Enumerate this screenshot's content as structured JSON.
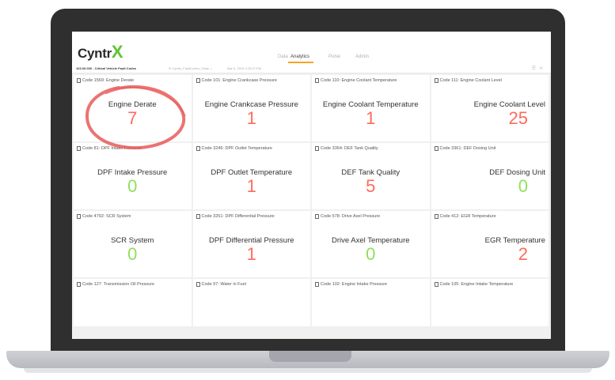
{
  "brand": {
    "name": "Cyntr",
    "accent_letter": "X"
  },
  "nav": {
    "tabs": [
      {
        "label": "Data",
        "active": false
      },
      {
        "label": "Analytics",
        "active": true
      },
      {
        "label": "Pulse",
        "active": false
      },
      {
        "label": "Admin",
        "active": false
      }
    ]
  },
  "subbar": {
    "title": "103.00.000 - Critical Vehicle Fault Codes",
    "source": "Cyntrx_FaultCodes_Clean",
    "date": "Mar 5, 2019 2:23:07 PM"
  },
  "colors": {
    "value_red": "#ff6a5c",
    "value_green": "#8fe05c",
    "tab_accent": "#f5a623",
    "annotation": "#e85a5a"
  },
  "tiles": [
    {
      "code": "Code 1569: Engine Derate",
      "title": "Engine Derate",
      "value": "7",
      "color": "red"
    },
    {
      "code": "Code 101: Engine Crankcase Pressure",
      "title": "Engine Crankcase Pressure",
      "value": "1",
      "color": "red"
    },
    {
      "code": "Code 110: Engine Coolant Temperature",
      "title": "Engine Coolant Temperature",
      "value": "1",
      "color": "red"
    },
    {
      "code": "Code 111: Engine Coolant Level",
      "title": "Engine Coolant Level",
      "value": "25",
      "color": "red"
    },
    {
      "code": "Code 81: DPF Intake Pressure",
      "title": "DPF Intake Pressure",
      "value": "0",
      "color": "green"
    },
    {
      "code": "Code 3246: DPF Outlet Temperature",
      "title": "DPF Outlet Temperature",
      "value": "1",
      "color": "red"
    },
    {
      "code": "Code 3364: DEF Tank Quality",
      "title": "DEF Tank Quality",
      "value": "5",
      "color": "red"
    },
    {
      "code": "Code 3361: DEF Dosing Unit",
      "title": "DEF Dosing Unit",
      "value": "0",
      "color": "green"
    },
    {
      "code": "Code 4792: SCR System",
      "title": "SCR System",
      "value": "0",
      "color": "green"
    },
    {
      "code": "Code 3251: DPF Differential Pressure",
      "title": "DPF Differential Pressure",
      "value": "1",
      "color": "red"
    },
    {
      "code": "Code 578: Drive Axel Pressure",
      "title": "Drive Axel Temperature",
      "value": "0",
      "color": "green"
    },
    {
      "code": "Code 412: EGR Temperature",
      "title": "EGR Temperature",
      "value": "2",
      "color": "red"
    },
    {
      "code": "Code 127: Transmission Oil Pressure"
    },
    {
      "code": "Code 97: Water in Fuel"
    },
    {
      "code": "Code 102: Engine Intake Pressure"
    },
    {
      "code": "Code 105: Engine Intake Temperature"
    }
  ]
}
